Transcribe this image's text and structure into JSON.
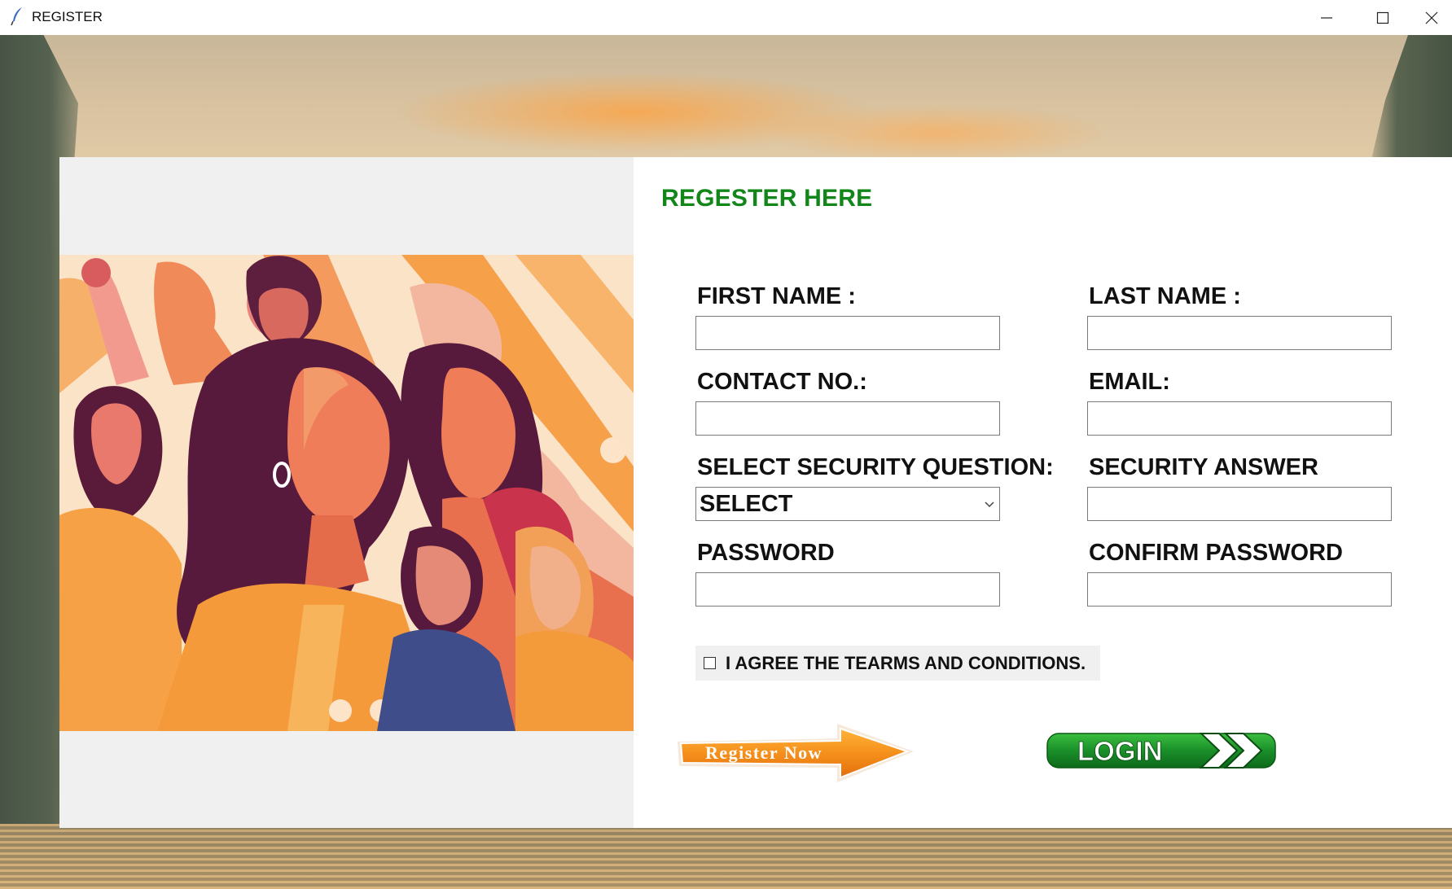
{
  "window": {
    "title": "REGISTER",
    "controls": [
      "minimize-icon",
      "maximize-icon",
      "close-icon"
    ]
  },
  "form": {
    "title": "REGESTER HERE",
    "fields": {
      "first_name": {
        "label": "FIRST NAME :",
        "value": ""
      },
      "last_name": {
        "label": "LAST NAME :",
        "value": ""
      },
      "contact": {
        "label": "CONTACT NO.:",
        "value": ""
      },
      "email": {
        "label": "EMAIL:",
        "value": ""
      },
      "security_question": {
        "label": "SELECT SECURITY QUESTION:",
        "value": "SELECT"
      },
      "security_answer": {
        "label": "SECURITY ANSWER",
        "value": ""
      },
      "password": {
        "label": "PASSWORD",
        "value": ""
      },
      "confirm_password": {
        "label": "CONFIRM PASSWORD",
        "value": ""
      }
    },
    "agree": {
      "label": "I AGREE THE TEARMS AND CONDITIONS.",
      "checked": false
    },
    "register_button": {
      "label": "Register Now"
    },
    "login_button": {
      "label": "LOGIN"
    }
  },
  "colors": {
    "title_green": "#13861a",
    "register_orange": "#f28a1d",
    "login_green": "#1a8f2a"
  }
}
